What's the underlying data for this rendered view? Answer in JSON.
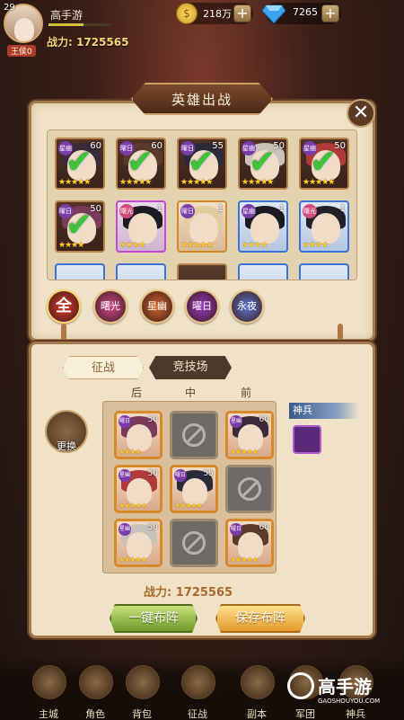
{
  "player": {
    "level": "29",
    "name": "高手游",
    "rank_badge": "王侯0",
    "power_label": "战力: 1725565",
    "xp_fraction": 0.55
  },
  "currency": {
    "gold": "218万",
    "gems": "7265"
  },
  "panel_title": "英雄出战",
  "hero_cards": [
    {
      "element": "星幽",
      "level": "60",
      "selected": true,
      "frame": "bronze",
      "hair": "#3a2a3a",
      "stars": 5
    },
    {
      "element": "曜日",
      "level": "60",
      "selected": true,
      "frame": "bronze",
      "hair": "#5a3a2a",
      "stars": 5
    },
    {
      "element": "曜日",
      "level": "55",
      "selected": true,
      "frame": "bronze",
      "hair": "#2a2a3a",
      "stars": 5
    },
    {
      "element": "星幽",
      "level": "50",
      "selected": true,
      "frame": "bronze",
      "hair": "#c9c2b8",
      "stars": 5
    },
    {
      "element": "星幽",
      "level": "50",
      "selected": true,
      "frame": "bronze",
      "hair": "#b03a3a",
      "stars": 5
    },
    {
      "element": "曜日",
      "level": "50",
      "selected": true,
      "frame": "bronze",
      "hair": "#7a3a5a",
      "stars": 4
    },
    {
      "element": "曙光",
      "level": "1",
      "selected": false,
      "frame": "purple",
      "hair": "#1e1a24",
      "stars": 4
    },
    {
      "element": "曜日",
      "level": "1",
      "selected": false,
      "frame": "gold",
      "hair": "#e2cda0",
      "stars": 5
    },
    {
      "element": "星幽",
      "level": "1",
      "selected": false,
      "frame": "blue",
      "hair": "#1a1a22",
      "stars": 4
    },
    {
      "element": "曙光",
      "level": "1",
      "selected": false,
      "frame": "blue",
      "hair": "#222028",
      "stars": 4
    }
  ],
  "filters": [
    {
      "label": "全",
      "color": "#e03a2a"
    },
    {
      "label": "曙光",
      "color": "#d54a8a"
    },
    {
      "label": "星幽",
      "color": "#d56a2a"
    },
    {
      "label": "曜日",
      "color": "#9a3ac0"
    },
    {
      "label": "永夜",
      "color": "#5a7ad0"
    }
  ],
  "tabs": {
    "active": "征战",
    "inactive": "竞技场"
  },
  "swap_label": "更换",
  "columns": [
    "后",
    "中",
    "前"
  ],
  "formation": [
    {
      "state": "hero",
      "element": "曜日",
      "level": "50",
      "hair": "#7a3a5a",
      "stars": 4
    },
    {
      "state": "empty"
    },
    {
      "state": "hero",
      "element": "星幽",
      "level": "60",
      "hair": "#3a2a3a",
      "stars": 5
    },
    {
      "state": "hero",
      "element": "星幽",
      "level": "50",
      "hair": "#b03a3a",
      "stars": 5
    },
    {
      "state": "hero",
      "element": "曜日",
      "level": "55",
      "hair": "#2a2a3a",
      "stars": 5
    },
    {
      "state": "empty"
    },
    {
      "state": "hero",
      "element": "星幽",
      "level": "50",
      "hair": "#c9c2b8",
      "stars": 5
    },
    {
      "state": "empty"
    },
    {
      "state": "hero",
      "element": "曜日",
      "level": "60",
      "hair": "#5a3a2a",
      "stars": 5
    }
  ],
  "shenbing_label": "神兵",
  "power_bottom": "战力: 1725565",
  "buttons": {
    "auto": "一键布阵",
    "save": "保存布阵"
  },
  "nav": [
    "主城",
    "角色",
    "背包",
    "征战",
    "副本",
    "军团",
    "神兵"
  ],
  "watermark": {
    "name": "高手游",
    "url": "GAOSHOUYOU.COM"
  }
}
